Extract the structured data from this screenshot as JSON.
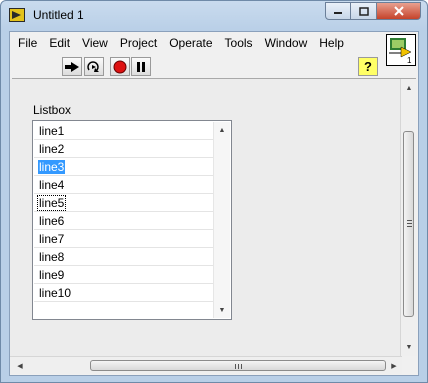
{
  "window": {
    "title": "Untitled 1"
  },
  "menu": [
    "File",
    "Edit",
    "View",
    "Project",
    "Operate",
    "Tools",
    "Window",
    "Help"
  ],
  "toolbar": {
    "run_icon": "run-arrow-icon",
    "run_continuous_icon": "run-continuously-icon",
    "abort_icon": "abort-stop-icon",
    "pause_icon": "pause-icon",
    "help_label": "?"
  },
  "vi_icon": {
    "badge": "1"
  },
  "listbox": {
    "label": "Listbox",
    "items": [
      "line1",
      "line2",
      "line3",
      "line4",
      "line5",
      "line6",
      "line7",
      "line8",
      "line9",
      "line10"
    ],
    "selected": "line3",
    "focused": "line5"
  },
  "scrollbars": {
    "hgrip": "|||",
    "vgrip": "≡"
  },
  "colors": {
    "selection": "#3399ff",
    "panel": "#ececec"
  }
}
